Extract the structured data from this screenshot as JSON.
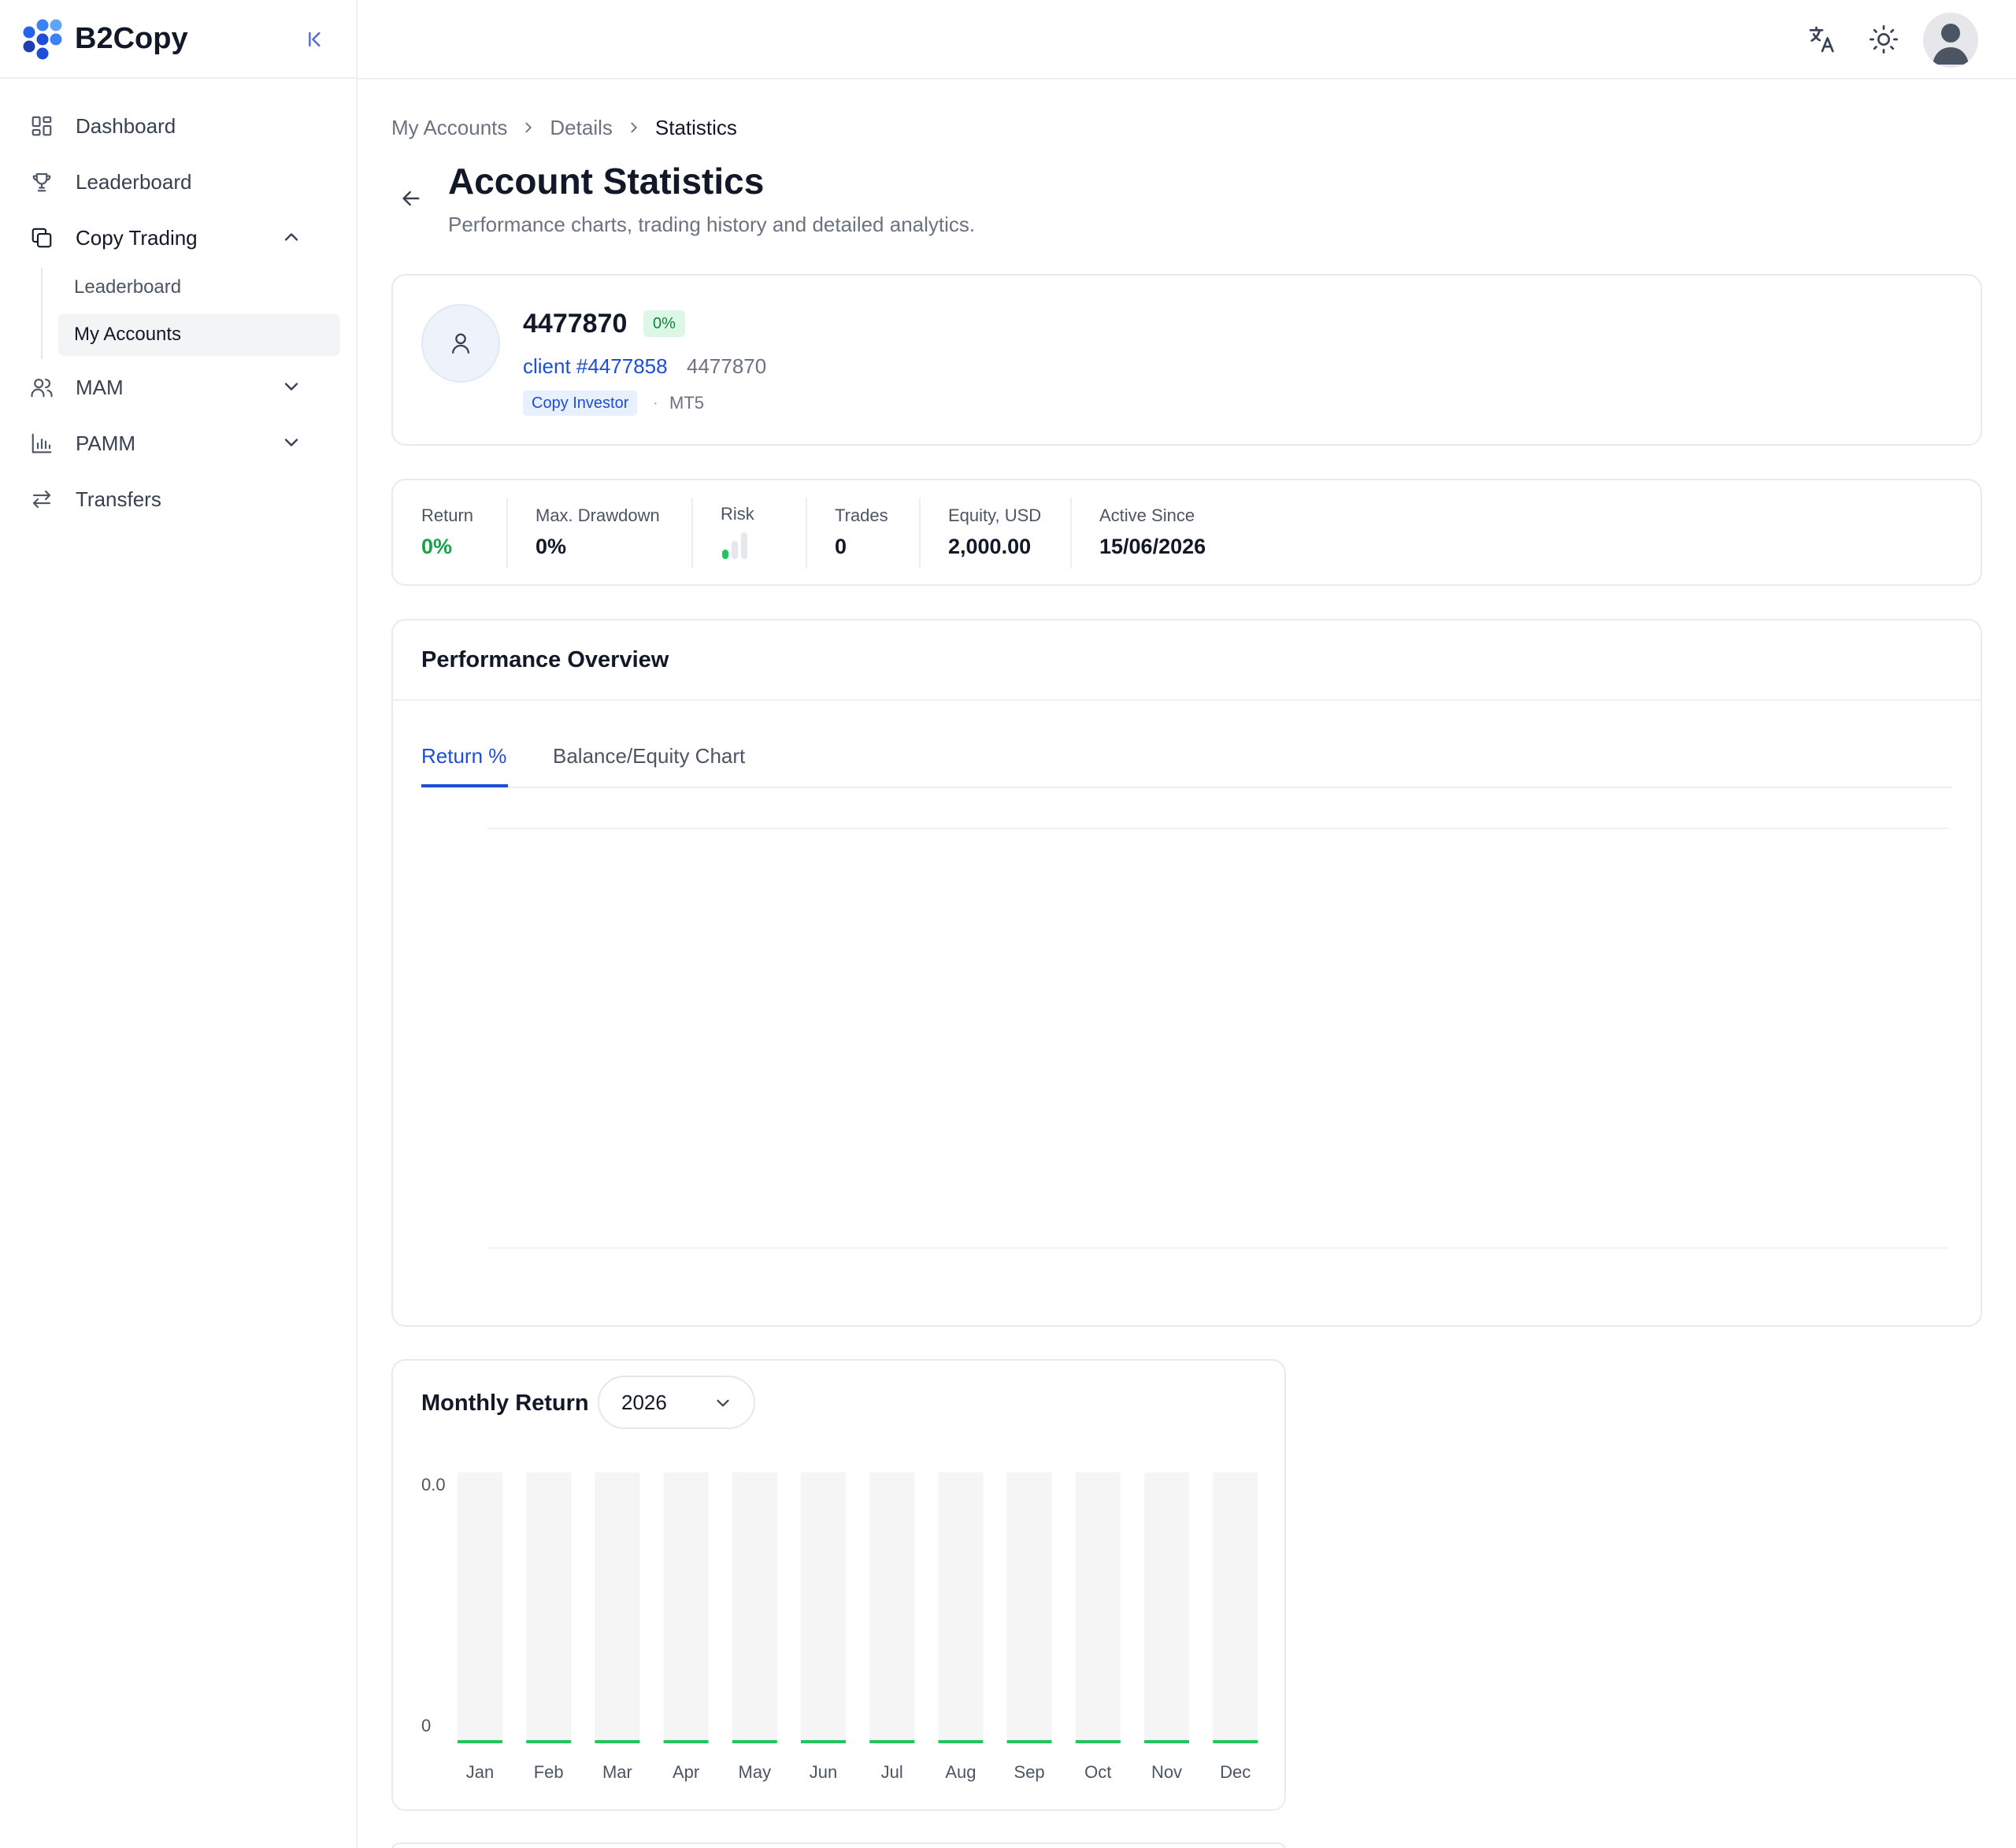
{
  "app": {
    "name": "B2Copy"
  },
  "colors": {
    "accent": "#1d4ed8",
    "positive": "#16a34a",
    "bar_bg": "#f5f5f5",
    "bar_line": "#22c55e"
  },
  "sidebar": {
    "items": [
      {
        "label": "Dashboard",
        "icon": "dashboard-icon"
      },
      {
        "label": "Leaderboard",
        "icon": "trophy-icon"
      },
      {
        "label": "Copy Trading",
        "icon": "copy-icon"
      },
      {
        "label": "MAM",
        "icon": "users-icon"
      },
      {
        "label": "PAMM",
        "icon": "bar-chart-icon"
      },
      {
        "label": "Transfers",
        "icon": "transfer-icon"
      }
    ],
    "copy_trading_sub": [
      {
        "label": "Leaderboard"
      },
      {
        "label": "My Accounts"
      }
    ]
  },
  "breadcrumb": [
    "My Accounts",
    "Details",
    "Statistics"
  ],
  "page": {
    "title": "Account Statistics",
    "subtitle": "Performance charts, trading history and detailed analytics."
  },
  "account": {
    "id": "4477870",
    "return_badge": "0%",
    "client_link": "client #4477858",
    "number": "4477870",
    "tag": "Copy Investor",
    "separator": "·",
    "platform": "MT5"
  },
  "stats": {
    "return_label": "Return",
    "return_value": "0%",
    "drawdown_label": "Max. Drawdown",
    "drawdown_value": "0%",
    "risk_label": "Risk",
    "risk_level": 1,
    "risk_max": 3,
    "trades_label": "Trades",
    "trades_value": "0",
    "equity_label": "Equity, USD",
    "equity_value": "2,000.00",
    "active_label": "Active Since",
    "active_value": "15/06/2026"
  },
  "performance": {
    "title": "Performance Overview",
    "tabs": [
      {
        "label": "Return %",
        "active": true
      },
      {
        "label": "Balance/Equity Chart",
        "active": false
      }
    ]
  },
  "monthly": {
    "title": "Monthly Return",
    "year": "2026",
    "y_ticks": [
      "0.0",
      "0"
    ]
  },
  "chart_data": {
    "type": "bar",
    "title": "Monthly Return",
    "categories": [
      "Jan",
      "Feb",
      "Mar",
      "Apr",
      "May",
      "Jun",
      "Jul",
      "Aug",
      "Sep",
      "Oct",
      "Nov",
      "Dec"
    ],
    "values": [
      0,
      0,
      0,
      0,
      0,
      0,
      0,
      0,
      0,
      0,
      0,
      0
    ],
    "y_tick_labels": [
      "0.0",
      "0"
    ],
    "grid": false
  }
}
